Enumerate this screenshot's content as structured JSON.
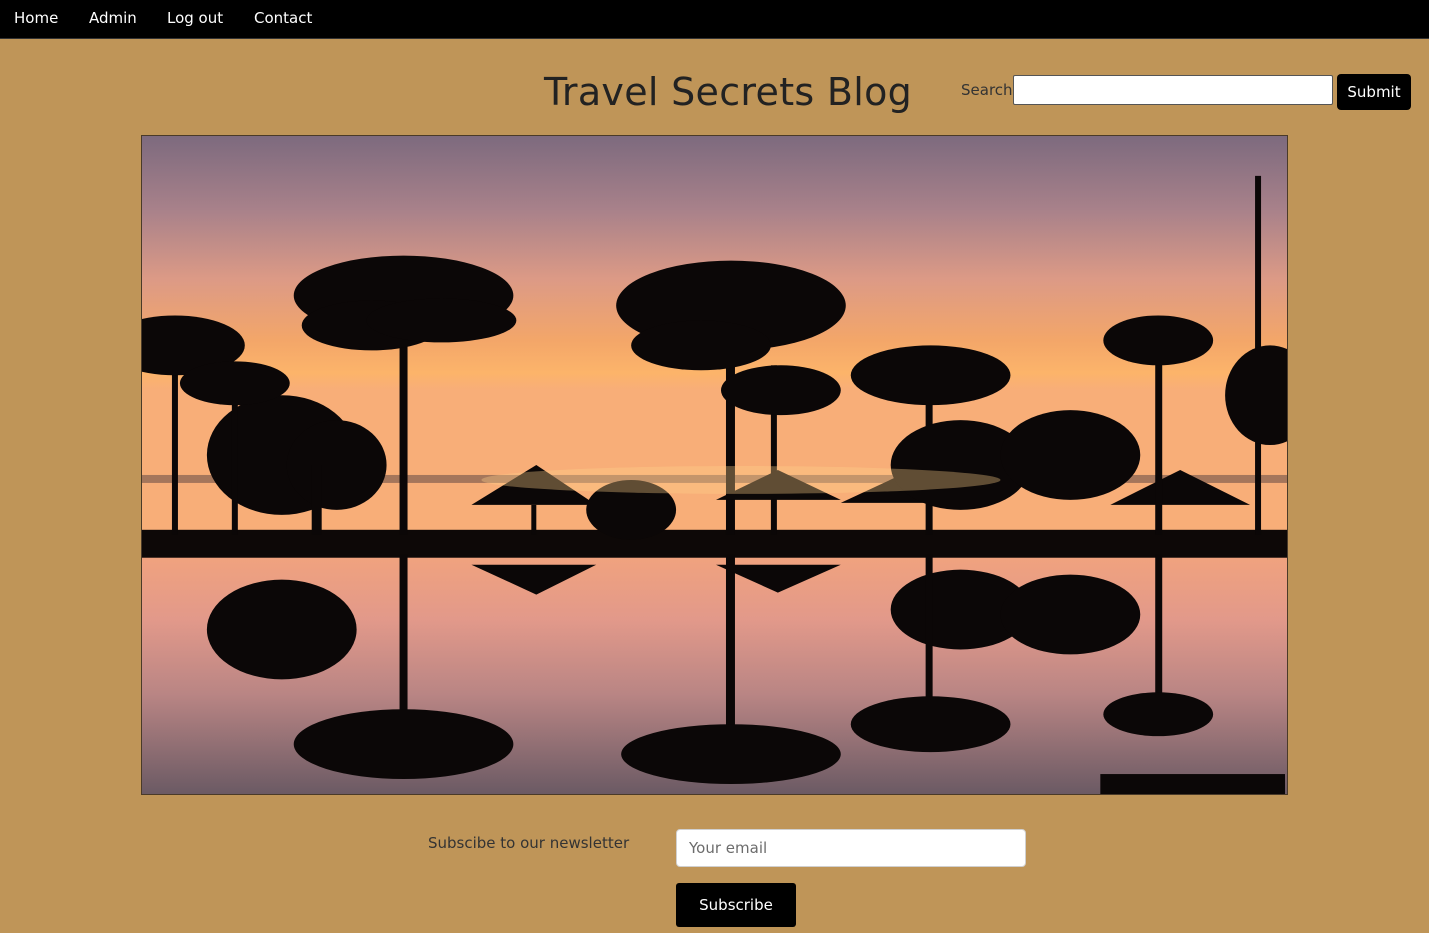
{
  "nav": {
    "items": [
      {
        "label": "Home"
      },
      {
        "label": "Admin"
      },
      {
        "label": "Log out"
      },
      {
        "label": "Contact"
      }
    ]
  },
  "header": {
    "title": "Travel Secrets Blog"
  },
  "search": {
    "label": "Search",
    "value": "",
    "submit_label": "Submit"
  },
  "hero": {
    "image": "tropical-sunset-palm-trees-reflection"
  },
  "newsletter": {
    "label": "Subscibe to our newsletter",
    "email_placeholder": "Your email",
    "subscribe_label": "Subscribe"
  },
  "colors": {
    "page_background": "#bf9558",
    "nav_background": "#000000",
    "button_background": "#000000"
  }
}
